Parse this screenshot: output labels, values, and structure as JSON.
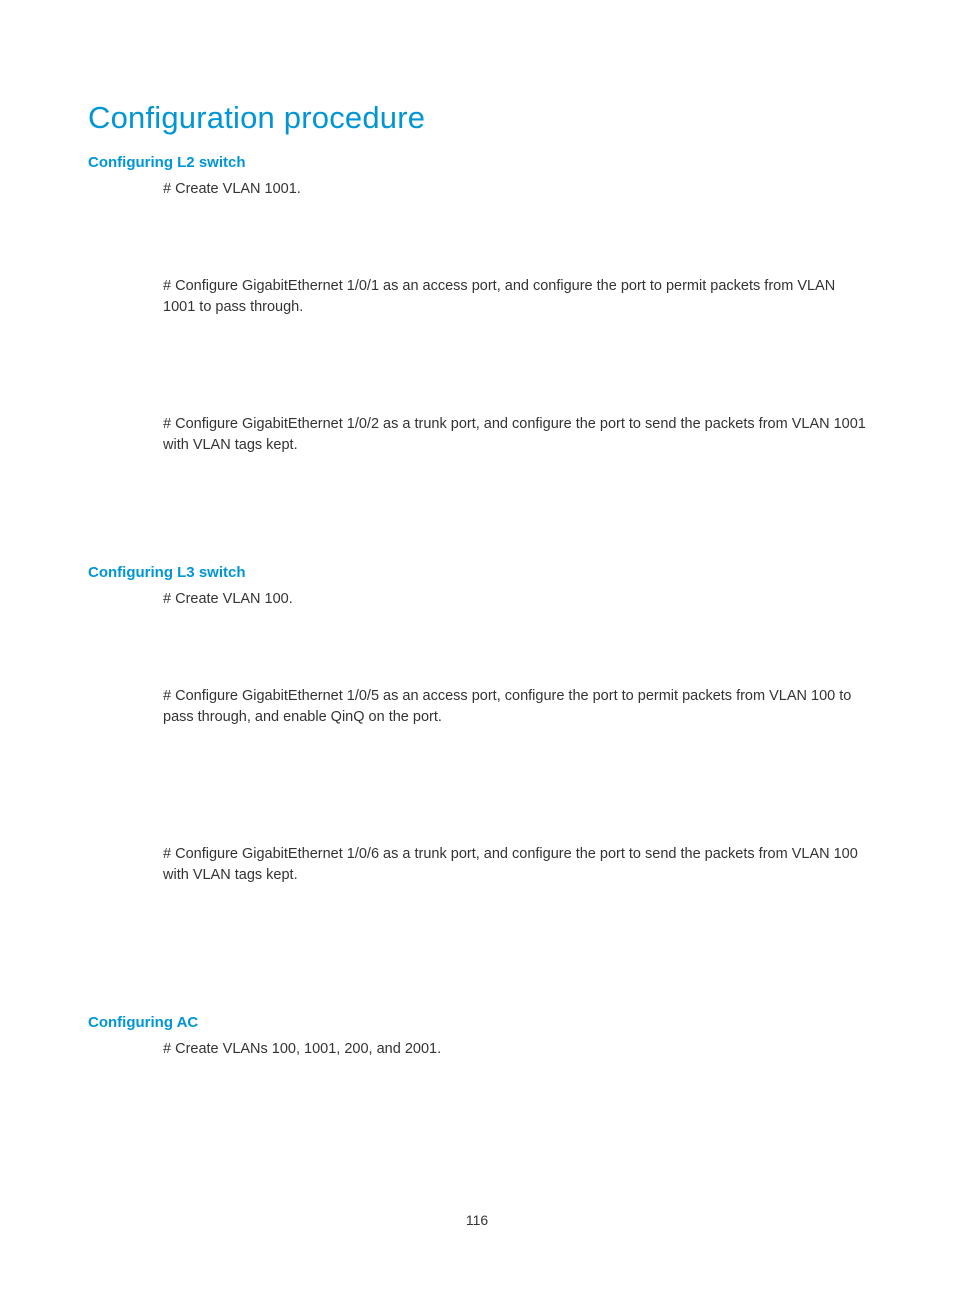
{
  "title": "Configuration procedure",
  "sections": {
    "l2": {
      "heading": "Configuring L2 switch",
      "p1": "# Create VLAN 1001.",
      "p2": "# Configure GigabitEthernet 1/0/1 as an access port, and configure the port to permit packets from VLAN 1001 to pass through.",
      "p3": "# Configure GigabitEthernet 1/0/2 as a trunk port, and configure the port to send the packets from VLAN 1001 with VLAN tags kept."
    },
    "l3": {
      "heading": "Configuring L3 switch",
      "p1": "# Create VLAN 100.",
      "p2": "# Configure GigabitEthernet 1/0/5 as an access port, configure the port to permit packets from VLAN 100 to pass through, and enable QinQ on the port.",
      "p3": "# Configure GigabitEthernet 1/0/6 as a trunk port, and configure the port to send the packets from VLAN 100 with VLAN tags kept."
    },
    "ac": {
      "heading": "Configuring AC",
      "p1": "# Create VLANs 100, 1001, 200, and 2001."
    }
  },
  "pagenum": "116"
}
